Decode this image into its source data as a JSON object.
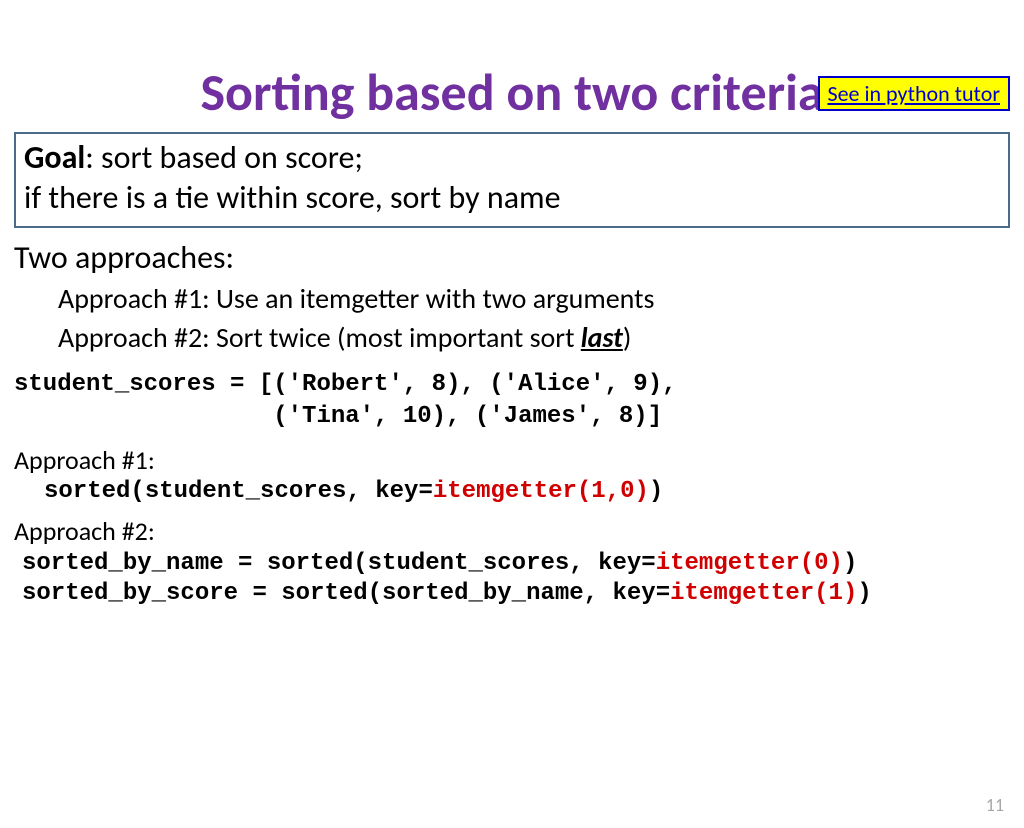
{
  "link": {
    "label": "See in python tutor"
  },
  "title": "Sorting based on two criteria",
  "goal": {
    "label": "Goal",
    "line1": ":  sort based on score;",
    "line2": " if there is a tie within score, sort by name"
  },
  "two_approaches": "Two approaches:",
  "approach1_desc": "Approach #1: Use an itemgetter with two arguments",
  "approach2_desc_pre": "Approach #2: Sort twice (most important sort ",
  "approach2_desc_last": "last",
  "approach2_desc_post": ")",
  "code_data": "student_scores = [('Robert', 8), ('Alice', 9), \n                  ('Tina', 10), ('James', 8)]",
  "approach1_label": "Approach #1:",
  "a1_code_black": "sorted(student_scores, key=",
  "a1_code_red": "itemgetter(1,0)",
  "a1_code_close": ")",
  "approach2_label": "Approach #2:",
  "a2_line1_black": "sorted_by_name = sorted(student_scores, key=",
  "a2_line1_red": "itemgetter(0)",
  "a2_line1_close": ")",
  "a2_line2_black": "sorted_by_score = sorted(sorted_by_name, key=",
  "a2_line2_red": "itemgetter(1)",
  "a2_line2_close": ")",
  "page_num": "11"
}
